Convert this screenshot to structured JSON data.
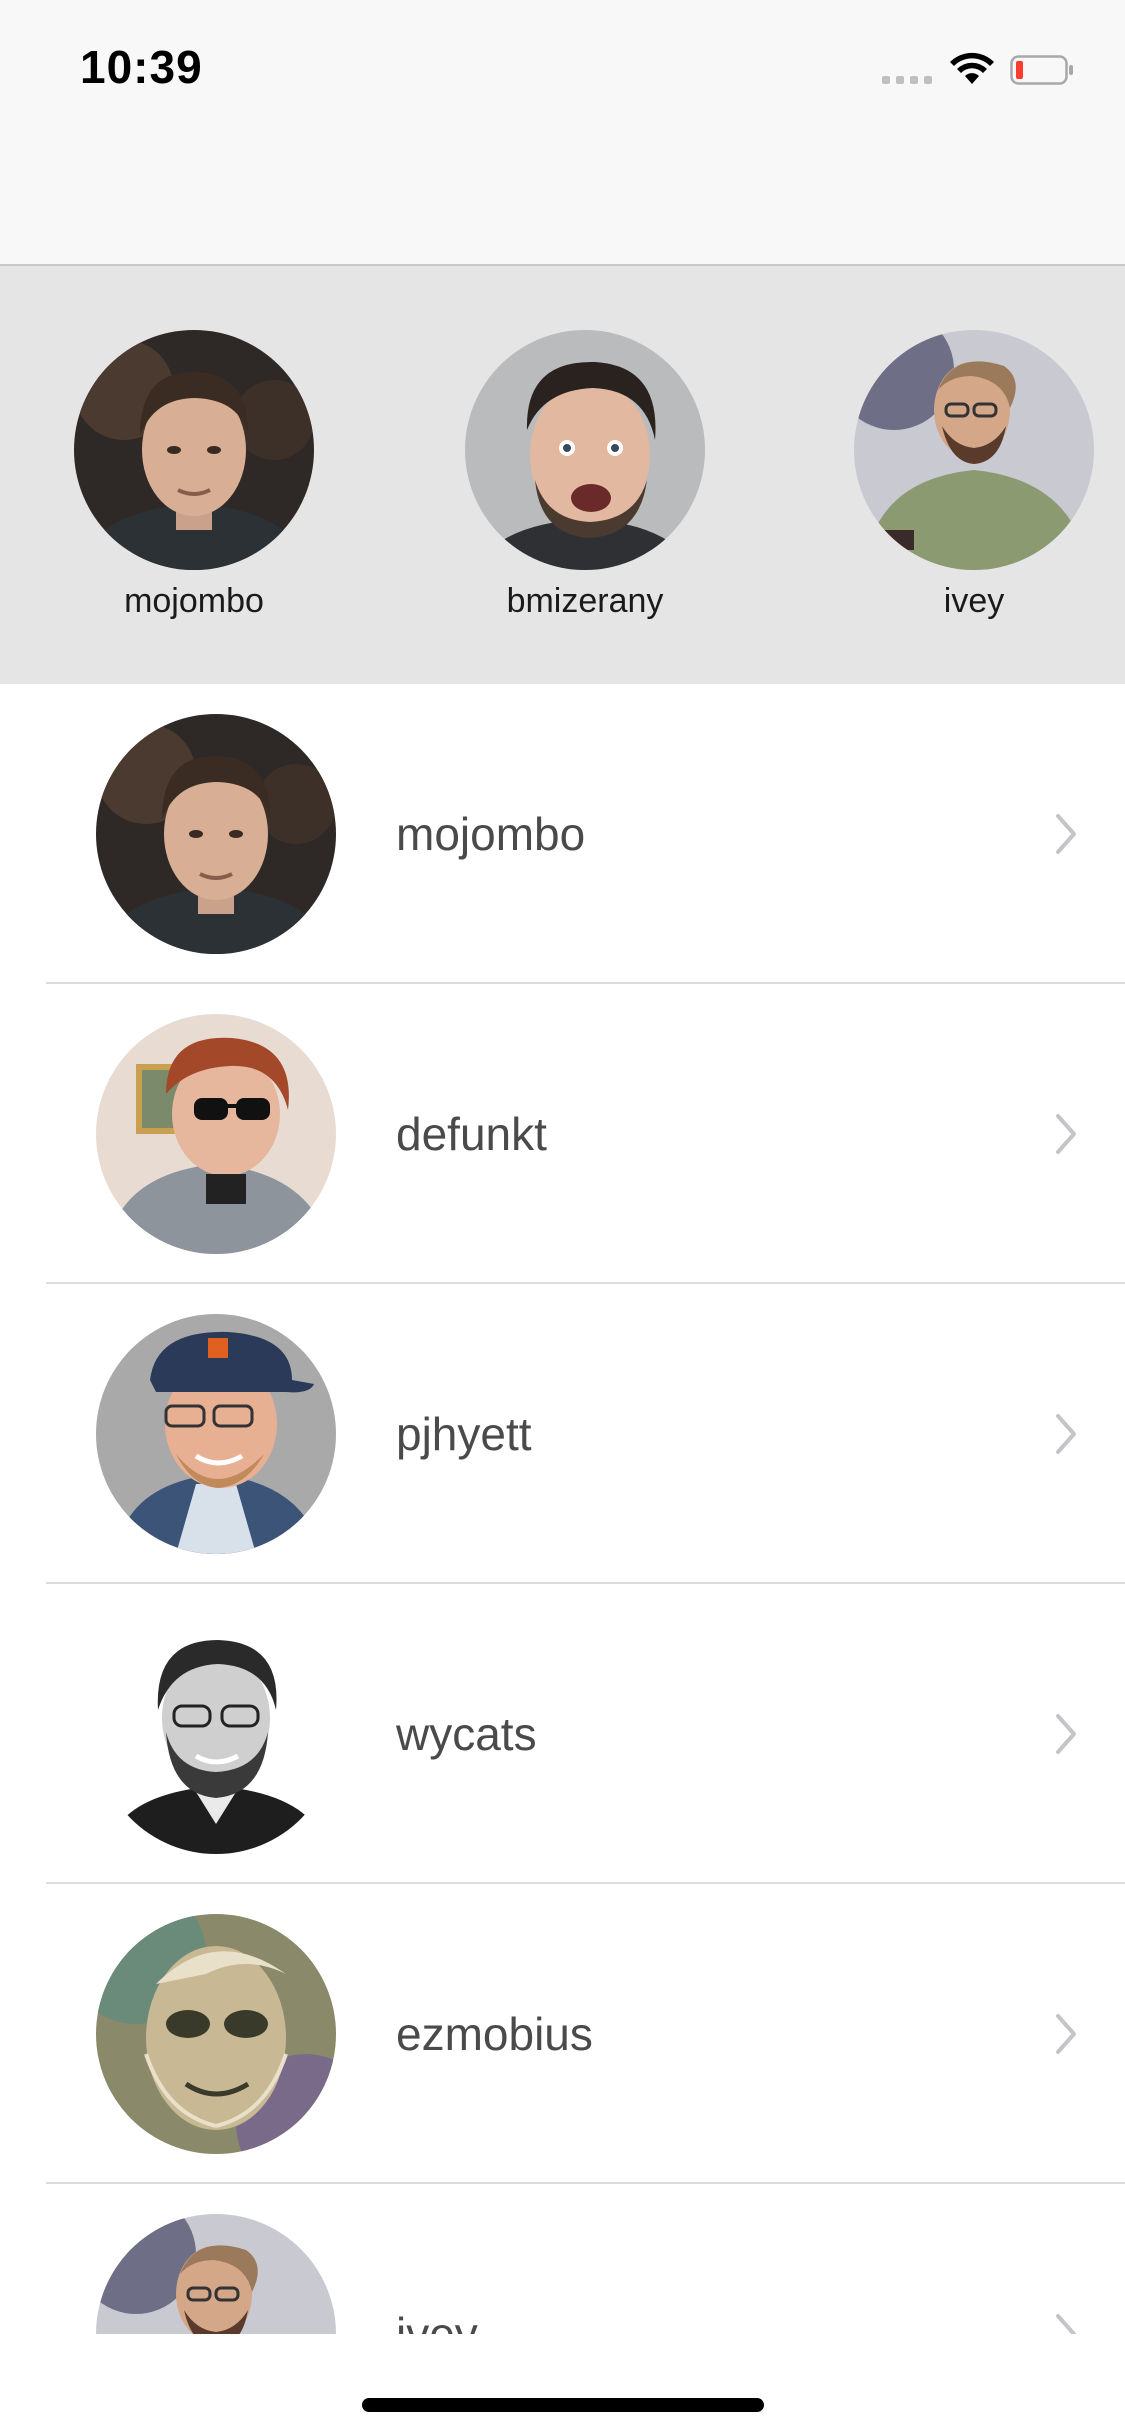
{
  "status_bar": {
    "time": "10:39",
    "signal_icon": "cellular-signal-icon",
    "wifi_icon": "wifi-icon",
    "battery_icon": "battery-low-icon",
    "battery_color": "#ff3b30"
  },
  "featured_users": [
    {
      "login": "mojombo",
      "avatar_icon": "avatar-mojombo"
    },
    {
      "login": "bmizerany",
      "avatar_icon": "avatar-bmizerany"
    },
    {
      "login": "ivey",
      "avatar_icon": "avatar-ivey"
    }
  ],
  "users": [
    {
      "login": "mojombo",
      "avatar_icon": "avatar-mojombo",
      "chevron_icon": "chevron-right-icon"
    },
    {
      "login": "defunkt",
      "avatar_icon": "avatar-defunkt",
      "chevron_icon": "chevron-right-icon"
    },
    {
      "login": "pjhyett",
      "avatar_icon": "avatar-pjhyett",
      "chevron_icon": "chevron-right-icon"
    },
    {
      "login": "wycats",
      "avatar_icon": "avatar-wycats",
      "chevron_icon": "chevron-right-icon"
    },
    {
      "login": "ezmobius",
      "avatar_icon": "avatar-ezmobius",
      "chevron_icon": "chevron-right-icon"
    },
    {
      "login": "ivey",
      "avatar_icon": "avatar-ivey",
      "chevron_icon": "chevron-right-icon"
    }
  ],
  "colors": {
    "featured_strip_bg": "#e5e5e5",
    "nav_bg": "#f8f8f8",
    "label_text": "#4a4a4a",
    "chevron": "#c4c4c9"
  }
}
